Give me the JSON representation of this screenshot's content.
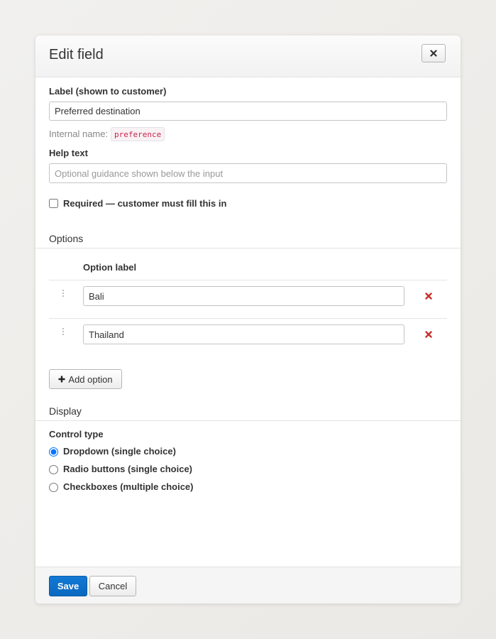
{
  "modal": {
    "title": "Edit field",
    "close_icon": "times-icon"
  },
  "field": {
    "label_caption": "Label (shown to customer)",
    "label_value": "Preferred destination",
    "internal_name_caption": "Internal name:",
    "internal_name": "preference",
    "help_caption": "Help text",
    "help_placeholder": "Optional guidance shown below the input",
    "help_value": "",
    "required_label": "Required — customer must fill this in",
    "required_checked": false
  },
  "options": {
    "section_title": "Options",
    "column_header": "Option label",
    "items": [
      {
        "label": "Bali"
      },
      {
        "label": "Thailand"
      }
    ],
    "add_label": "Add option",
    "remove_color": "#c9302c"
  },
  "display": {
    "section_title": "Display",
    "control_type_caption": "Control type",
    "choices": [
      {
        "label": "Dropdown (single choice)",
        "selected": true
      },
      {
        "label": "Radio buttons (single choice)",
        "selected": false
      },
      {
        "label": "Checkboxes (multiple choice)",
        "selected": false
      }
    ]
  },
  "footer": {
    "save_label": "Save",
    "cancel_label": "Cancel",
    "primary_color": "#0b6bc7"
  }
}
